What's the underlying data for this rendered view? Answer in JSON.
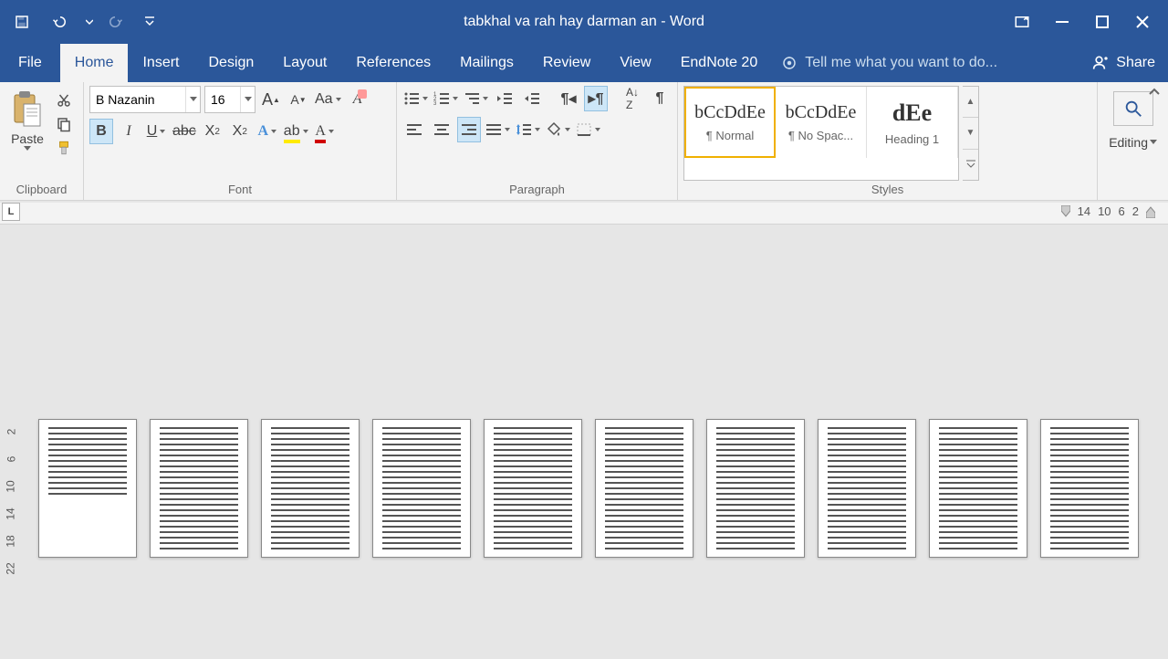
{
  "title": "tabkhal va rah hay darman an - Word",
  "tabs": {
    "file": "File",
    "home": "Home",
    "insert": "Insert",
    "design": "Design",
    "layout": "Layout",
    "references": "References",
    "mailings": "Mailings",
    "review": "Review",
    "view": "View",
    "endnote": "EndNote 20"
  },
  "tellme_placeholder": "Tell me what you want to do...",
  "share_label": "Share",
  "groups": {
    "clipboard": {
      "label": "Clipboard",
      "paste": "Paste"
    },
    "font": {
      "label": "Font",
      "name": "B Nazanin",
      "size": "16"
    },
    "paragraph": {
      "label": "Paragraph"
    },
    "styles": {
      "label": "Styles",
      "items": [
        {
          "preview": "bCcDdEe",
          "name": "¶ Normal"
        },
        {
          "preview": "bCcDdEe",
          "name": "¶ No Spac..."
        },
        {
          "preview": "dEe",
          "name": "Heading 1"
        }
      ]
    },
    "editing": {
      "label": "Editing"
    }
  },
  "hruler": [
    "14",
    "10",
    "6",
    "2"
  ],
  "vruler": [
    "22",
    "18",
    "14",
    "10",
    "6",
    "2"
  ],
  "corner": "L"
}
